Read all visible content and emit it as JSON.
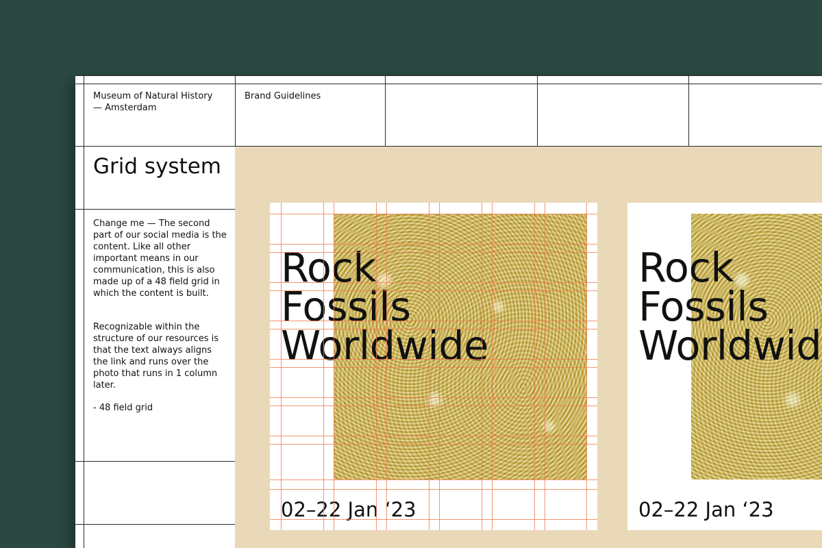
{
  "header": {
    "museum": "Museum of Natural History — Amsterdam",
    "section": "Brand Guidelines"
  },
  "sidebar": {
    "title": "Grid system",
    "paragraphs": [
      "Change me — The second part of our social media is the content. Like all other important means in our communication, this is also made up of a 48 field grid in which the content is built.",
      "Recognizable within the structure of our resources is that the text always aligns the link and runs over the photo that runs in 1 column later.",
      "- 48 field grid"
    ]
  },
  "cards": [
    {
      "headline": [
        "Rock",
        "Fossils",
        "Worldwide"
      ],
      "date": "02–22 Jan ‘23",
      "grid_visible": true
    },
    {
      "headline": [
        "Rock",
        "Fossils",
        "Worldwide"
      ],
      "date": "02–22 Jan ‘23",
      "grid_visible": false
    }
  ],
  "colors": {
    "background": "#2b4842",
    "panel": "#ead9b8",
    "photo": "#c9ad3f",
    "grid_guides": "#f07a4c"
  }
}
